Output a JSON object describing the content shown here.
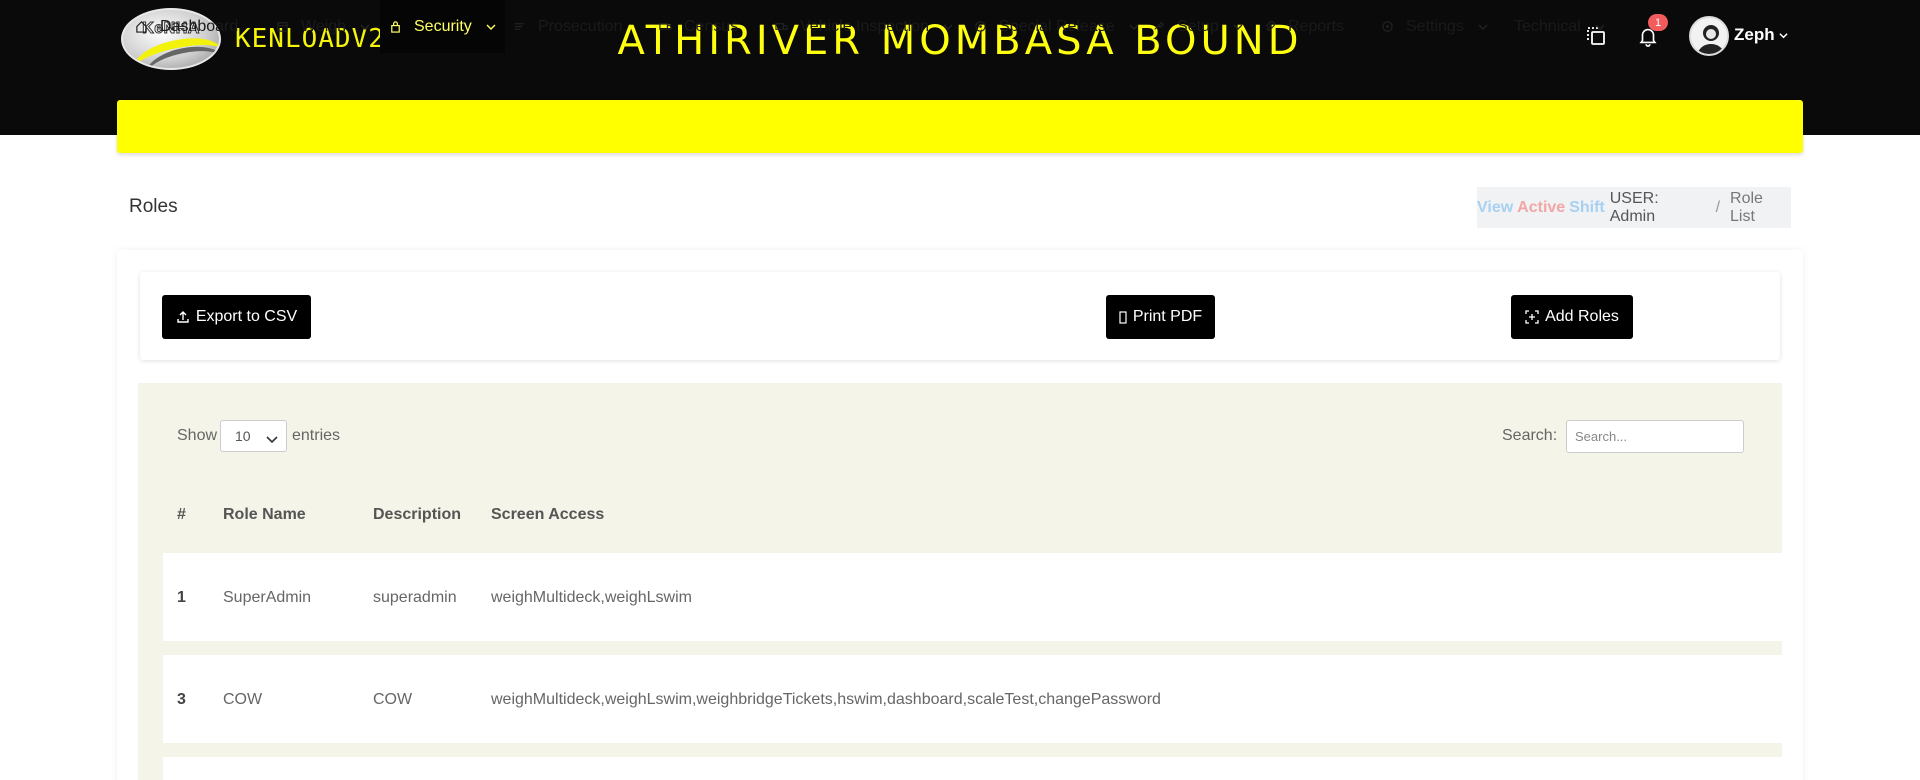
{
  "header": {
    "logo_brand": "KeNHA",
    "app_name": "KENLOADV2",
    "station_title": "ATHIRIVER MOMBASA BOUND",
    "notification_count": "1",
    "user_name": "Zeph"
  },
  "nav": {
    "items": [
      {
        "label": "Dashboard",
        "icon": "home-icon",
        "dropdown": false
      },
      {
        "label": "Weigh",
        "icon": "scale-icon",
        "dropdown": true
      },
      {
        "label": "Security",
        "icon": "lock-icon",
        "dropdown": true,
        "active": true
      },
      {
        "label": "Prosecution",
        "icon": "list-icon",
        "dropdown": false
      },
      {
        "label": "Census",
        "icon": "truck-icon",
        "dropdown": false
      },
      {
        "label": "Vehicle Inspection",
        "icon": "truck-icon",
        "dropdown": true
      },
      {
        "label": "Special Release",
        "icon": "circle-icon",
        "dropdown": true
      },
      {
        "label": "Setup",
        "icon": "setup-icon",
        "dropdown": true
      },
      {
        "label": "Reports",
        "icon": "paperclip-icon",
        "dropdown": false
      },
      {
        "label": "Settings",
        "icon": "circle-icon",
        "dropdown": true
      },
      {
        "label": "Technical",
        "icon": "",
        "dropdown": true
      }
    ],
    "colors": {
      "bar": "#ffff00",
      "active_bg": "#050505",
      "active_text": "#ffff66"
    }
  },
  "page": {
    "title": "Roles",
    "breadcrumb": {
      "view": "View",
      "active": "Active",
      "shift": "Shift",
      "user": "USER: Admin",
      "separator": "/",
      "current": "Role List"
    }
  },
  "toolbar": {
    "export_label": "Export to CSV",
    "print_label": "Print PDF",
    "add_label": "Add Roles"
  },
  "table": {
    "show_label": "Show",
    "entries_value": "10",
    "entries_label": "entries",
    "search_label": "Search:",
    "search_placeholder": "Search...",
    "columns": [
      "#",
      "Role Name",
      "Description",
      "Screen Access"
    ],
    "rows": [
      {
        "num": "1",
        "role": "SuperAdmin",
        "description": "superadmin",
        "access": "weighMultideck,weighLswim"
      },
      {
        "num": "3",
        "role": "COW",
        "description": "COW",
        "access": "weighMultideck,weighLswim,weighbridgeTickets,hswim,dashboard,scaleTest,changePassword"
      }
    ]
  }
}
